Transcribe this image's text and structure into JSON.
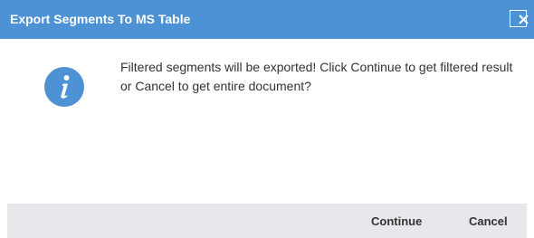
{
  "dialog": {
    "title": "Export Segments To MS Table",
    "message": "Filtered segments will be exported! Click Continue to get filtered result or Cancel to get entire document?",
    "icon": "info-icon",
    "buttons": {
      "continue_label": "Continue",
      "cancel_label": "Cancel"
    },
    "colors": {
      "titlebar": "#4e92d6",
      "icon": "#4e92d6",
      "footer": "#e8e8ec",
      "text": "#333333"
    }
  }
}
